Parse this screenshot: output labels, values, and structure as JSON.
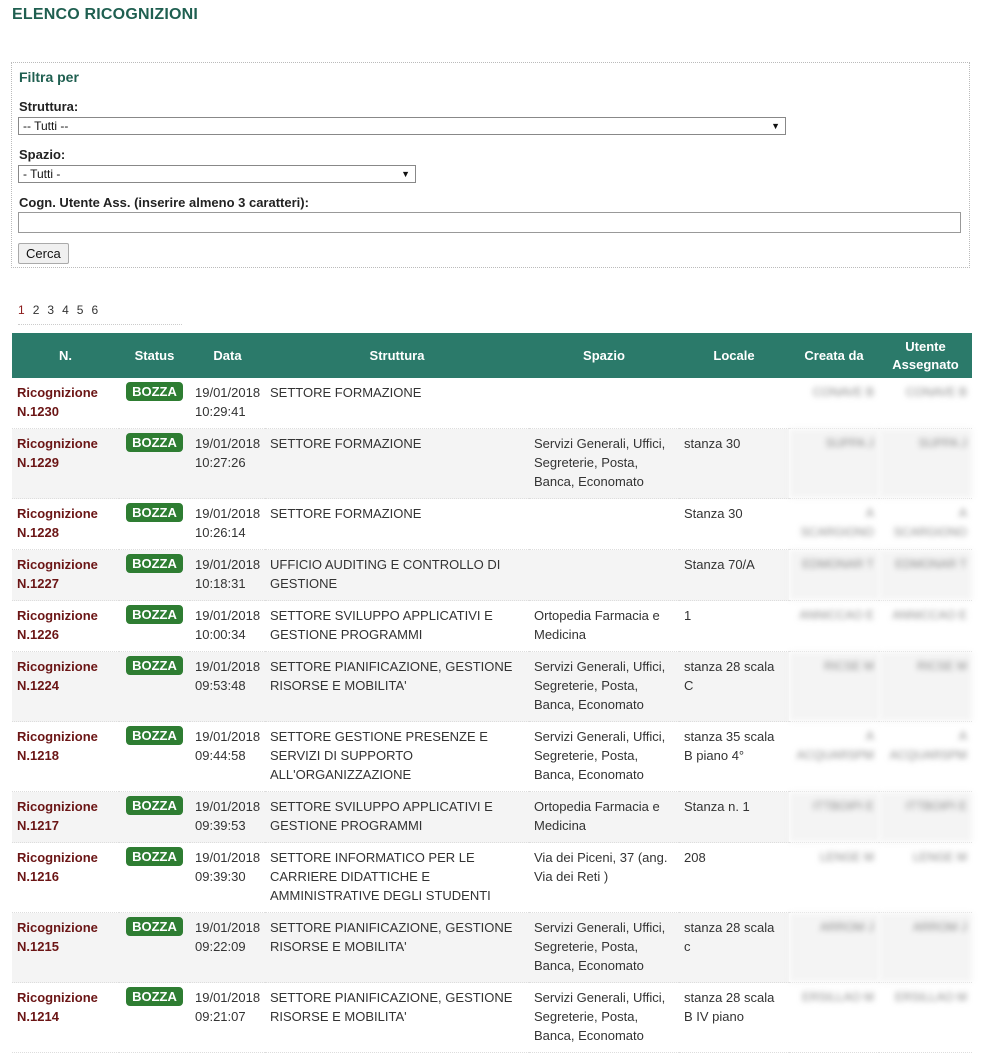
{
  "page": {
    "title": "ELENCO RICOGNIZIONI"
  },
  "filter": {
    "title": "Filtra per",
    "struttura_label": "Struttura:",
    "struttura_value": "-- Tutti --",
    "spazio_label": "Spazio:",
    "spazio_value": "- Tutti -",
    "utente_label": "Cogn. Utente Ass. (inserire almeno 3 caratteri):",
    "utente_value": "",
    "search_label": "Cerca"
  },
  "pager": {
    "pages": [
      "1",
      "2",
      "3",
      "4",
      "5",
      "6"
    ],
    "current": "1"
  },
  "table": {
    "headers": [
      "N.",
      "Status",
      "Data",
      "Struttura",
      "Spazio",
      "Locale",
      "Creata da",
      "Utente Assegnato"
    ],
    "rows": [
      {
        "num": "Ricognizione N.1230",
        "status": "BOZZA",
        "date": "19/01/2018 10:29:41",
        "struttura": "SETTORE FORMAZIONE",
        "spazio": "",
        "locale": "",
        "creata": "CONAVE B",
        "utente": "CONAVE B"
      },
      {
        "num": "Ricognizione N.1229",
        "status": "BOZZA",
        "date": "19/01/2018 10:27:26",
        "struttura": "SETTORE FORMAZIONE",
        "spazio": "Servizi Generali, Uffici, Segreterie, Posta, Banca, Economato",
        "locale": "stanza 30",
        "creata": "SUPPA J",
        "utente": "SUPPA J"
      },
      {
        "num": "Ricognizione N.1228",
        "status": "BOZZA",
        "date": "19/01/2018 10:26:14",
        "struttura": "SETTORE FORMAZIONE",
        "spazio": "",
        "locale": "Stanza 30",
        "creata": "A SCARGIONO",
        "utente": "A SCARGIONO"
      },
      {
        "num": "Ricognizione N.1227",
        "status": "BOZZA",
        "date": "19/01/2018 10:18:31",
        "struttura": "UFFICIO AUDITING E CONTROLLO DI GESTIONE",
        "spazio": "",
        "locale": "Stanza 70/A",
        "creata": "EDMONAR T",
        "utente": "EDMONAR T"
      },
      {
        "num": "Ricognizione N.1226",
        "status": "BOZZA",
        "date": "19/01/2018 10:00:34",
        "struttura": "SETTORE SVILUPPO APPLICATIVI E GESTIONE PROGRAMMI",
        "spazio": "Ortopedia Farmacia e Medicina",
        "locale": "1",
        "creata": "ANNICCAO E",
        "utente": "ANNICCAO E"
      },
      {
        "num": "Ricognizione N.1224",
        "status": "BOZZA",
        "date": "19/01/2018 09:53:48",
        "struttura": "SETTORE PIANIFICAZIONE, GESTIONE RISORSE E MOBILITA'",
        "spazio": "Servizi Generali, Uffici, Segreterie, Posta, Banca, Economato",
        "locale": "stanza 28 scala C",
        "creata": "RICSE M",
        "utente": "RICSE M"
      },
      {
        "num": "Ricognizione N.1218",
        "status": "BOZZA",
        "date": "19/01/2018 09:44:58",
        "struttura": "SETTORE GESTIONE PRESENZE E SERVIZI DI SUPPORTO ALL'ORGANIZZAZIONE",
        "spazio": "Servizi Generali, Uffici, Segreterie, Posta, Banca, Economato",
        "locale": "stanza 35 scala B piano 4°",
        "creata": "A ACQUARSPM",
        "utente": "A ACQUARSPM"
      },
      {
        "num": "Ricognizione N.1217",
        "status": "BOZZA",
        "date": "19/01/2018 09:39:53",
        "struttura": "SETTORE SVILUPPO APPLICATIVI E GESTIONE PROGRAMMI",
        "spazio": "Ortopedia Farmacia e Medicina",
        "locale": "Stanza n. 1",
        "creata": "ITTBOIPI E",
        "utente": "ITTBOIPI E"
      },
      {
        "num": "Ricognizione N.1216",
        "status": "BOZZA",
        "date": "19/01/2018 09:39:30",
        "struttura": "SETTORE INFORMATICO PER LE CARRIERE DIDATTICHE E AMMINISTRATIVE DEGLI STUDENTI",
        "spazio": "Via dei Piceni, 37 (ang. Via dei Reti )",
        "locale": "208",
        "creata": "LENGE M",
        "utente": "LENGE M"
      },
      {
        "num": "Ricognizione N.1215",
        "status": "BOZZA",
        "date": "19/01/2018 09:22:09",
        "struttura": "SETTORE PIANIFICAZIONE, GESTIONE RISORSE E MOBILITA'",
        "spazio": "Servizi Generali, Uffici, Segreterie, Posta, Banca, Economato",
        "locale": "stanza 28 scala c",
        "creata": "ARROM J",
        "utente": "ARROM J"
      },
      {
        "num": "Ricognizione N.1214",
        "status": "BOZZA",
        "date": "19/01/2018 09:21:07",
        "struttura": "SETTORE PIANIFICAZIONE, GESTIONE RISORSE E MOBILITA'",
        "spazio": "Servizi Generali, Uffici, Segreterie, Posta, Banca, Economato",
        "locale": "stanza 28 scala B IV piano",
        "creata": "ERSILLAO M",
        "utente": "ERSILLAO M"
      }
    ]
  }
}
